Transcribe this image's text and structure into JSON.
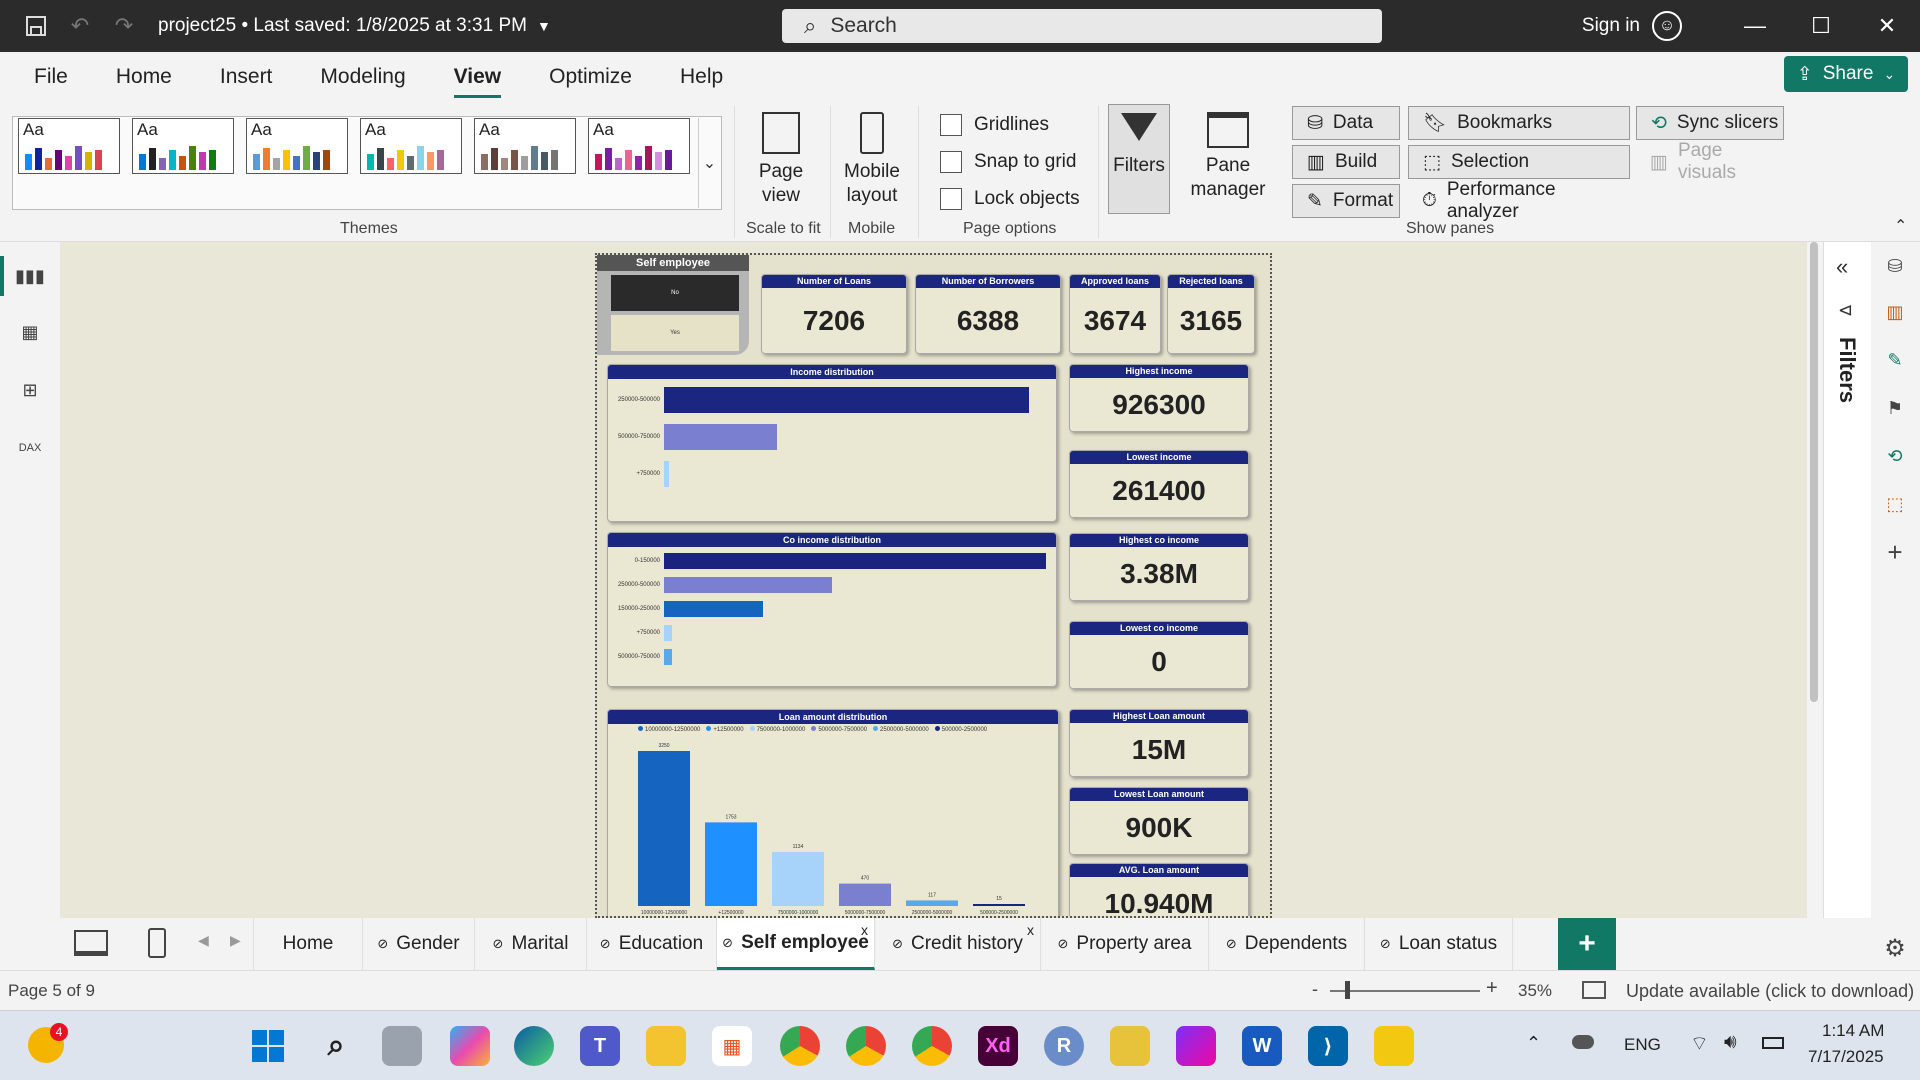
{
  "titlebar": {
    "title": "project25 • Last saved: 1/8/2025 at 3:31 PM",
    "search_placeholder": "Search",
    "sign_in": "Sign in"
  },
  "menu": {
    "items": [
      "File",
      "Home",
      "Insert",
      "Modeling",
      "View",
      "Optimize",
      "Help"
    ],
    "active": "View",
    "share": "Share"
  },
  "ribbon": {
    "themes_label": "Themes",
    "theme_aa": "Aa",
    "page_view": "Page view",
    "scale_to_fit": "Scale to fit",
    "mobile_layout": "Mobile layout",
    "mobile": "Mobile",
    "gridlines": "Gridlines",
    "snap_to_grid": "Snap to grid",
    "lock_objects": "Lock objects",
    "page_options": "Page options",
    "filters": "Filters",
    "pane_manager": "Pane manager",
    "data": "Data",
    "build": "Build",
    "format": "Format",
    "bookmarks": "Bookmarks",
    "selection": "Selection",
    "performance_analyzer": "Performance analyzer",
    "sync_slicers": "Sync slicers",
    "page_visuals": "Page visuals",
    "show_panes": "Show panes"
  },
  "report": {
    "slicer_title": "Self employee",
    "slicer_items": [
      "No",
      "Yes"
    ],
    "kpis": {
      "loans_label": "Number of Loans",
      "loans_value": "7206",
      "borrowers_label": "Number of Borrowers",
      "borrowers_value": "6388",
      "approved_label": "Approved loans",
      "approved_value": "3674",
      "rejected_label": "Rejected loans",
      "rejected_value": "3165",
      "high_income_label": "Highest income",
      "high_income_value": "926300",
      "low_income_label": "Lowest income",
      "low_income_value": "261400",
      "high_co_label": "Highest co income",
      "high_co_value": "3.38M",
      "low_co_label": "Lowest co income",
      "low_co_value": "0",
      "high_loan_label": "Highest Loan amount",
      "high_loan_value": "15M",
      "low_loan_label": "Lowest Loan amount",
      "low_loan_value": "900K",
      "avg_loan_label": "AVG. Loan amount",
      "avg_loan_value": "10.940M"
    },
    "income_title": "Income distribution",
    "co_income_title": "Co income distribution",
    "loan_title": "Loan amount distribution"
  },
  "chart_data": [
    {
      "type": "bar",
      "title": "Income distribution",
      "categories": [
        "250000-500000",
        "500000-750000",
        "+750000"
      ],
      "values": [
        100,
        31,
        1.5
      ]
    },
    {
      "type": "bar",
      "title": "Co income distribution",
      "categories": [
        "0-150000",
        "250000-500000",
        "150000-250000",
        "+750000",
        "500000-750000"
      ],
      "values": [
        100,
        44,
        26,
        2,
        2
      ]
    },
    {
      "type": "bar",
      "title": "Loan amount distribution",
      "categories": [
        "10000000-12500000",
        "+12500000",
        "7500000-1000000",
        "5000000-7500000",
        "2500000-5000000",
        "500000-2500000"
      ],
      "series": [
        {
          "values": [
            3250,
            1753,
            1134,
            470,
            117,
            15
          ]
        }
      ],
      "legend": [
        "10000000-12500000",
        "+12500000",
        "7500000-1000000",
        "5000000-7500000",
        "2500000-5000000",
        "500000-2500000"
      ],
      "colors": [
        "#1565c0",
        "#1e90ff",
        "#a7d3fb",
        "#7b7fcf",
        "#5ba8e8",
        "#1a237e"
      ]
    }
  ],
  "tabs": {
    "items": [
      "Home",
      "Gender",
      "Marital",
      "Education",
      "Self employee",
      "Credit history",
      "Property area",
      "Dependents",
      "Loan status"
    ],
    "active": "Self employee",
    "add": "+"
  },
  "status": {
    "page": "Page 5 of 9",
    "zoom": "35%",
    "update": "Update available (click to download)"
  },
  "taskbar": {
    "lang": "ENG",
    "time": "1:14 AM",
    "date": "7/17/2025",
    "badge": "4"
  },
  "colors": {
    "accent": "#117865",
    "header_blue": "#1b2680",
    "canvas": "#e9e7d7"
  }
}
